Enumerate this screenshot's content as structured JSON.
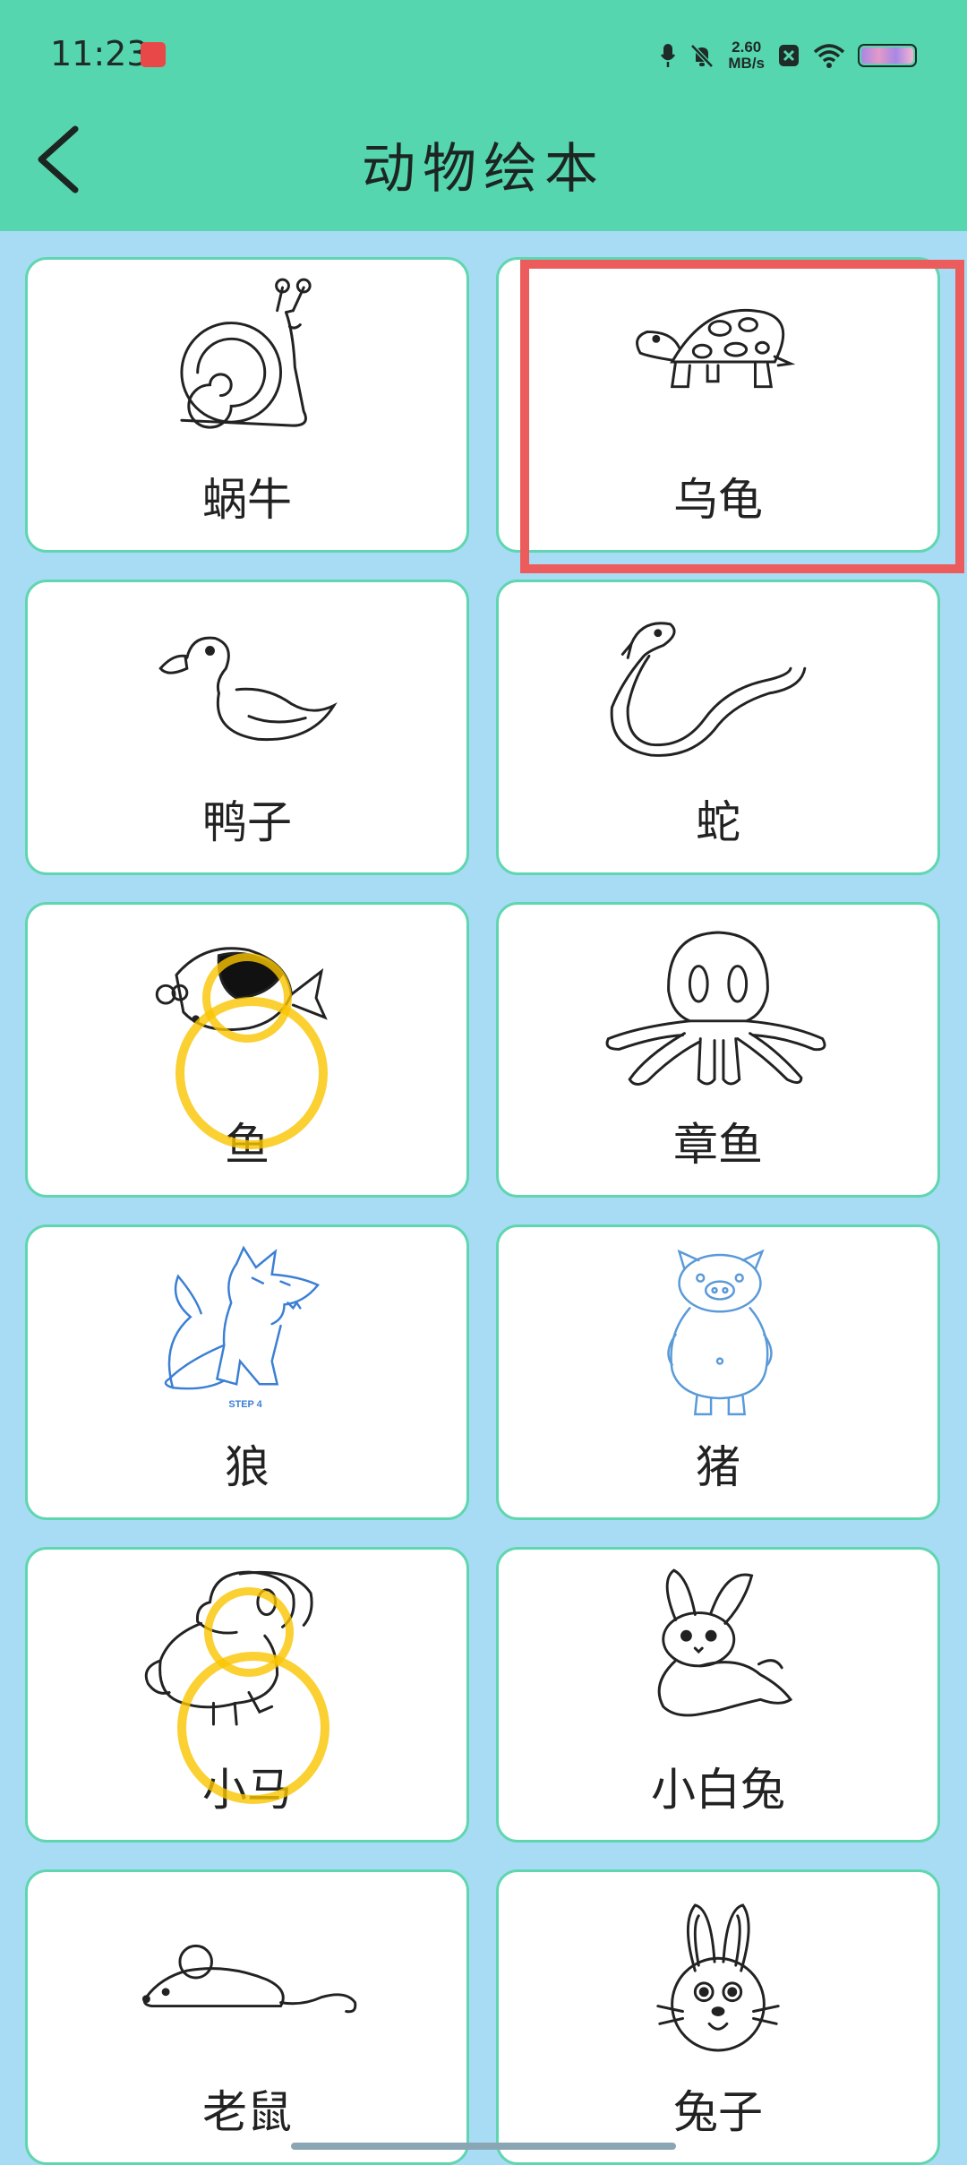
{
  "status_bar": {
    "time": "11:23",
    "speed_value": "2.60",
    "speed_unit": "MB/s",
    "icons": [
      "notification-app-icon",
      "microphone-icon",
      "mute-icon",
      "speed-indicator",
      "sim-icon",
      "wifi-icon",
      "battery-icon"
    ]
  },
  "header": {
    "title": "动物绘本",
    "back_icon": "chevron-left-icon"
  },
  "animals": [
    {
      "label": "蜗牛",
      "icon": "snail-drawing"
    },
    {
      "label": "乌龟",
      "icon": "turtle-drawing"
    },
    {
      "label": "鸭子",
      "icon": "duck-drawing"
    },
    {
      "label": "蛇",
      "icon": "snake-drawing"
    },
    {
      "label": "鱼",
      "icon": "fish-drawing"
    },
    {
      "label": "章鱼",
      "icon": "octopus-drawing"
    },
    {
      "label": "狼",
      "icon": "wolf-drawing",
      "caption": "STEP 4"
    },
    {
      "label": "猪",
      "icon": "pig-drawing"
    },
    {
      "label": "小马",
      "icon": "pony-drawing"
    },
    {
      "label": "小白兔",
      "icon": "white-rabbit-drawing"
    },
    {
      "label": "老鼠",
      "icon": "mouse-drawing"
    },
    {
      "label": "兔子",
      "icon": "rabbit-drawing"
    }
  ],
  "colors": {
    "header_bg": "#55d6ae",
    "page_bg": "#a8dcf4",
    "card_border": "#60d6b0",
    "highlight": "#ec5c5c",
    "tap_marker": "#fac400",
    "wolf_line": "#3b7fd4",
    "pig_line": "#5a9ad8"
  }
}
